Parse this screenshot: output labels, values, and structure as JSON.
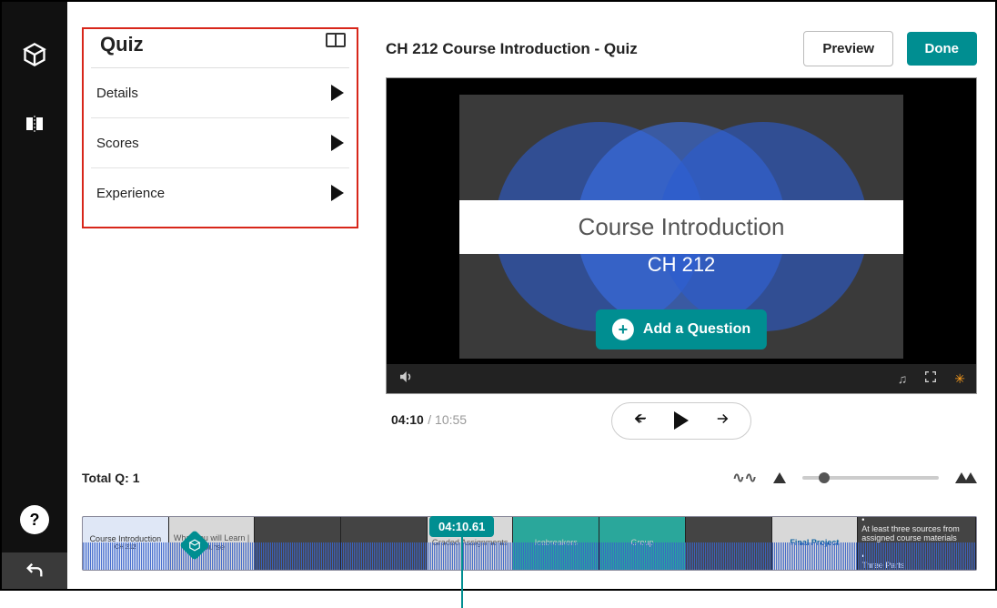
{
  "sidebar": {
    "title": "Quiz",
    "items": [
      {
        "label": "Details"
      },
      {
        "label": "Scores"
      },
      {
        "label": "Experience"
      }
    ]
  },
  "header": {
    "title": "CH 212 Course Introduction - Quiz",
    "preview_label": "Preview",
    "done_label": "Done"
  },
  "video": {
    "slide_title": "Course Introduction",
    "slide_subtitle": "CH 212",
    "add_question_label": "Add a Question"
  },
  "playback": {
    "current": "04:10",
    "total": "10:55"
  },
  "timeline": {
    "total_q_label": "Total Q: 1",
    "playhead": "04:10.61",
    "thumbs": [
      {
        "caption": "Course Introduction",
        "sub": "CH 212"
      },
      {
        "caption": "What you will Learn | Course"
      },
      {
        "caption": ""
      },
      {
        "caption": ""
      },
      {
        "caption": "Graded Assignments"
      },
      {
        "caption": "Icebreakers"
      },
      {
        "caption": "Group"
      },
      {
        "caption": ""
      },
      {
        "caption": "Final Project"
      },
      {
        "caption": "At least three sources from assigned course materials",
        "sub": "Three Parts"
      }
    ]
  },
  "help_glyph": "?"
}
